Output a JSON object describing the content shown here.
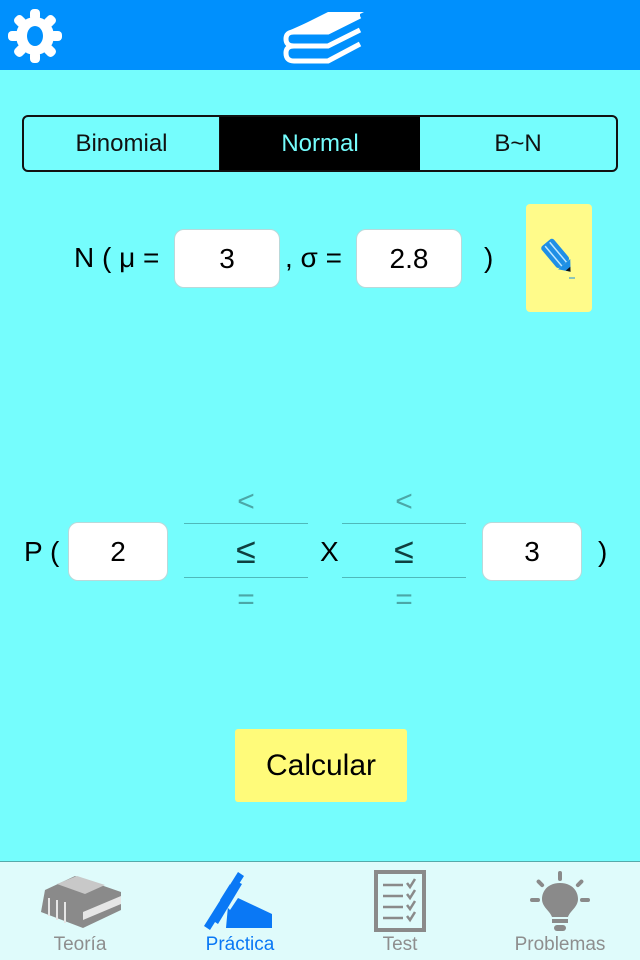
{
  "header": {
    "left_icon": "gear-icon",
    "center_icon": "books-icon",
    "colors": {
      "bar": "#0090fd",
      "background": "#75fdfd"
    }
  },
  "segments": {
    "items": [
      {
        "label": "Binomial",
        "selected": false
      },
      {
        "label": "Normal",
        "selected": true
      },
      {
        "label": "B~N",
        "selected": false
      }
    ]
  },
  "distribution": {
    "prefix": "N ( μ =",
    "mu_value": "3",
    "sigma_label": ", σ =",
    "sigma_value": "2.8",
    "close": ")",
    "edit_icon": "pencil-icon"
  },
  "probability": {
    "prefix": "P (",
    "lower_value": "2",
    "variable": "X",
    "upper_value": "3",
    "close": ")",
    "left_picker": {
      "options": [
        "<",
        "≤",
        "="
      ],
      "selected": "≤"
    },
    "right_picker": {
      "options": [
        "<",
        "≤",
        "="
      ],
      "selected": "≤"
    }
  },
  "actions": {
    "calculate_label": "Calcular"
  },
  "tabbar": {
    "items": [
      {
        "label": "Teoría",
        "icon": "book-icon",
        "active": false
      },
      {
        "label": "Práctica",
        "icon": "hand-writing-icon",
        "active": true
      },
      {
        "label": "Test",
        "icon": "checklist-icon",
        "active": false
      },
      {
        "label": "Problemas",
        "icon": "lightbulb-icon",
        "active": false
      }
    ]
  }
}
